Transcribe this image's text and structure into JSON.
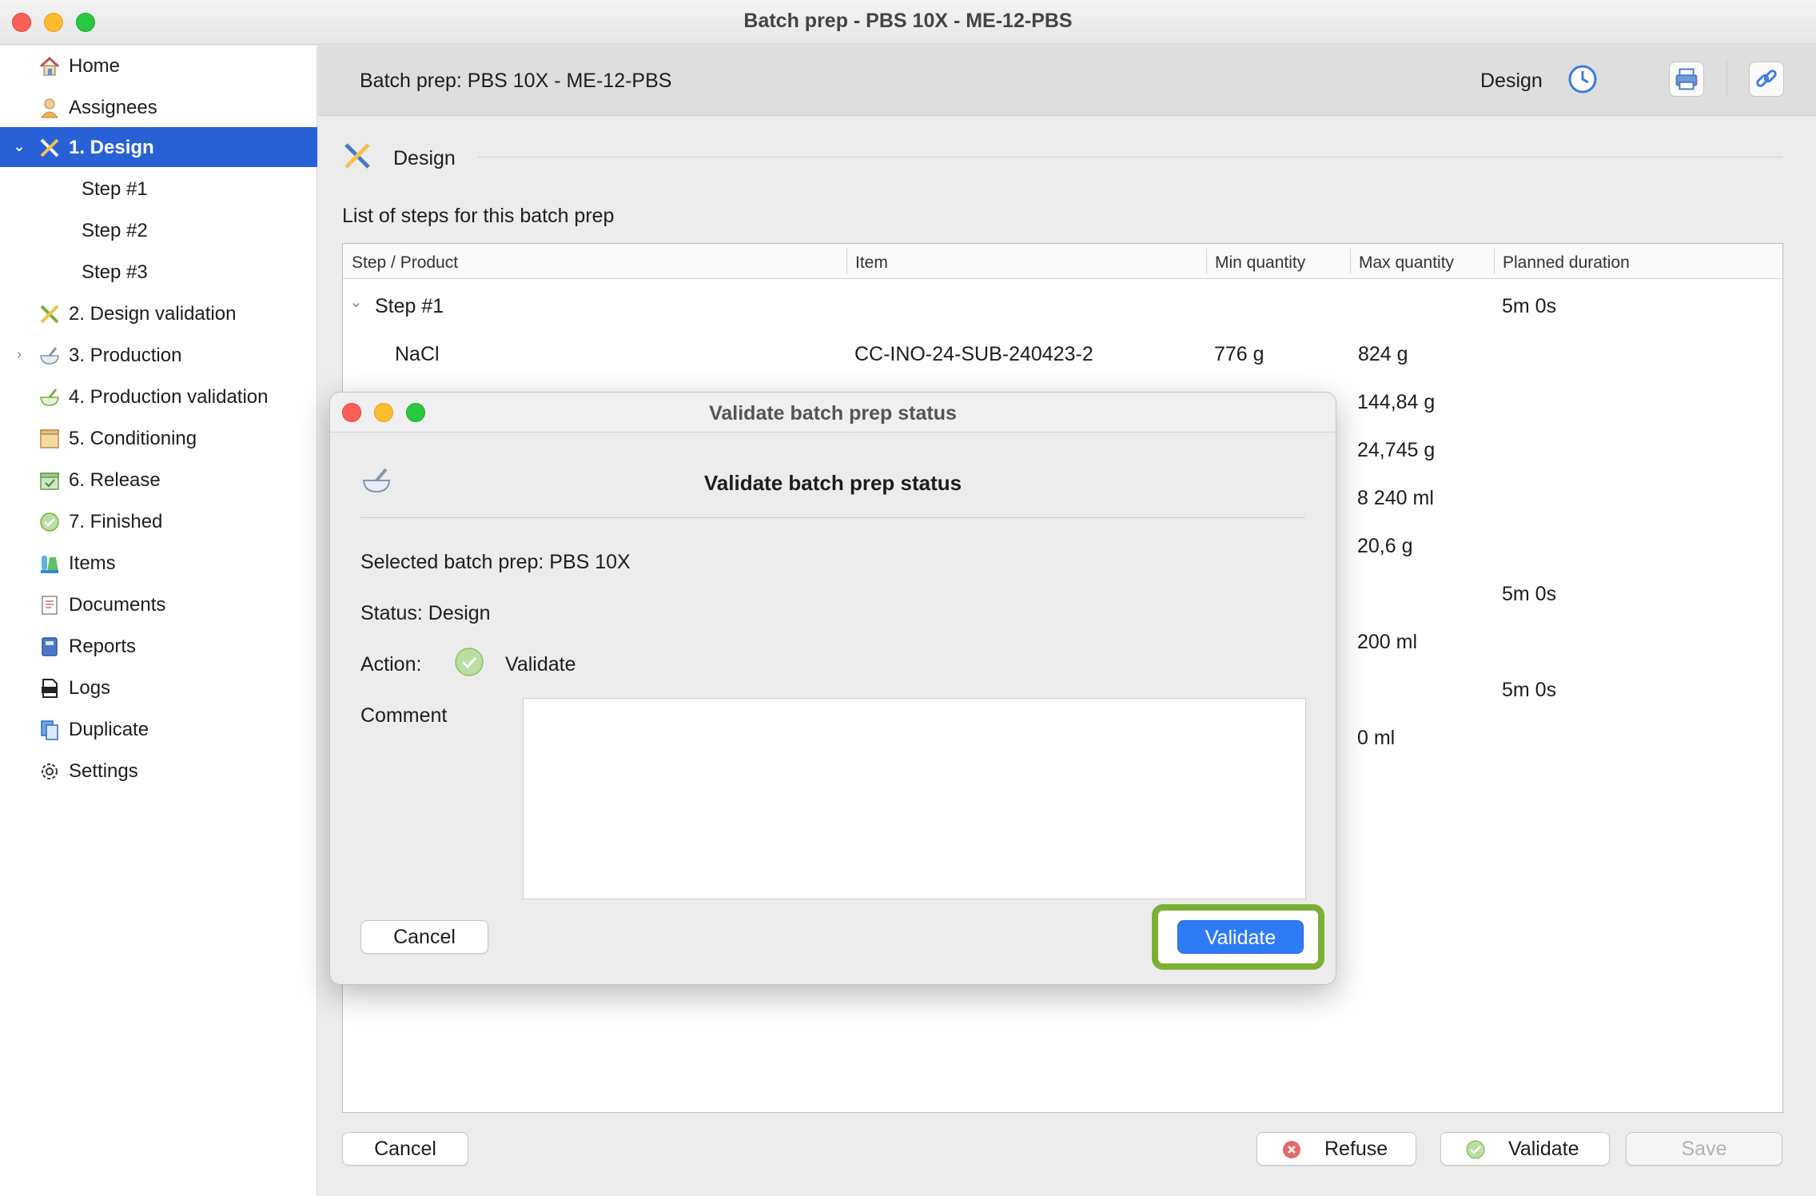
{
  "window": {
    "title": "Batch prep - PBS 10X - ME-12-PBS"
  },
  "sidebar": {
    "items": [
      {
        "label": "Home",
        "icon": "home-icon"
      },
      {
        "label": "Assignees",
        "icon": "person-icon"
      },
      {
        "label": "1. Design",
        "icon": "design-tools-icon",
        "selected": true,
        "expanded": true
      },
      {
        "label": "Step #1"
      },
      {
        "label": "Step #2"
      },
      {
        "label": "Step #3"
      },
      {
        "label": "2. Design validation",
        "icon": "design-validation-icon"
      },
      {
        "label": "3. Production",
        "icon": "mortar-icon",
        "collapsed": true
      },
      {
        "label": "4. Production validation",
        "icon": "mortar-check-icon"
      },
      {
        "label": "5. Conditioning",
        "icon": "box-icon"
      },
      {
        "label": "6. Release",
        "icon": "release-box-icon"
      },
      {
        "label": "7. Finished",
        "icon": "check-circle-icon"
      },
      {
        "label": "Items",
        "icon": "flask-icon"
      },
      {
        "label": "Documents",
        "icon": "document-icon"
      },
      {
        "label": "Reports",
        "icon": "report-book-icon"
      },
      {
        "label": "Logs",
        "icon": "log-icon"
      },
      {
        "label": "Duplicate",
        "icon": "duplicate-icon"
      },
      {
        "label": "Settings",
        "icon": "gear-icon"
      }
    ]
  },
  "header": {
    "title": "Batch prep: PBS 10X - ME-12-PBS",
    "status": "Design",
    "icons": [
      "clock-icon",
      "print-icon",
      "link-icon"
    ]
  },
  "section": {
    "title": "Design",
    "caption": "List of steps for this batch prep"
  },
  "table": {
    "columns": [
      "Step / Product",
      "Item",
      "Min quantity",
      "Max quantity",
      "Planned duration"
    ],
    "step1": {
      "label": "Step #1",
      "duration": "5m 0s"
    },
    "nacl": {
      "product": "NaCl",
      "item": "CC-INO-24-SUB-240423-2",
      "min": "776 g",
      "max": "824 g"
    },
    "visible_max": [
      "144,84 g",
      "24,745 g",
      "8 240 ml",
      "20,6 g"
    ],
    "duration_2": "5m 0s",
    "max_200": "200 ml",
    "duration_3": "5m 0s",
    "max_0": "0 ml"
  },
  "footer": {
    "cancel": "Cancel",
    "refuse": "Refuse",
    "validate": "Validate",
    "save": "Save"
  },
  "dialog": {
    "title": "Validate batch prep status",
    "heading": "Validate batch prep status",
    "selected": "Selected batch prep: PBS 10X",
    "status": "Status: Design",
    "action_label": "Action:",
    "action_value": "Validate",
    "comment_label": "Comment",
    "comment_value": "",
    "cancel": "Cancel",
    "validate": "Validate"
  },
  "colors": {
    "selection": "#2761d5",
    "primary_button": "#2f7bf6",
    "highlight": "#7cb035"
  }
}
